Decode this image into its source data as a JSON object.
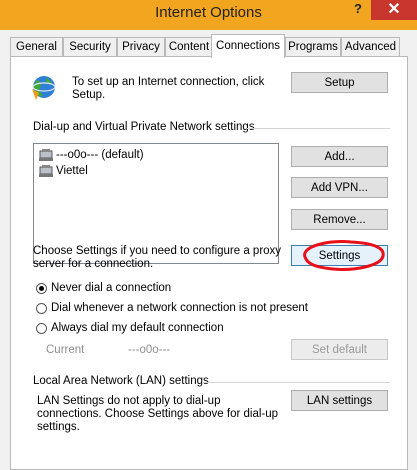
{
  "window": {
    "title": "Internet Options",
    "help_label": "?",
    "close_label": "✕",
    "titlebar_color": "#f2a51f",
    "close_color": "#c7352c"
  },
  "tabs": [
    {
      "label": "General"
    },
    {
      "label": "Security"
    },
    {
      "label": "Privacy"
    },
    {
      "label": "Content"
    },
    {
      "label": "Connections",
      "active": true
    },
    {
      "label": "Programs"
    },
    {
      "label": "Advanced"
    }
  ],
  "setup": {
    "text": "To set up an Internet connection, click Setup.",
    "button": "Setup"
  },
  "dialup": {
    "group_label": "Dial-up and Virtual Private Network settings",
    "connections": [
      {
        "name": "---o0o--- (default)"
      },
      {
        "name": "Viettel"
      }
    ],
    "add_button": "Add...",
    "add_vpn_button": "Add VPN...",
    "remove_button": "Remove...",
    "proxy_text": "Choose Settings if you need to configure a proxy server for a connection.",
    "settings_button": "Settings",
    "radios": [
      {
        "label": "Never dial a connection",
        "checked": true
      },
      {
        "label": "Dial whenever a network connection is not present",
        "checked": false
      },
      {
        "label": "Always dial my default connection",
        "checked": false
      }
    ],
    "current_label": "Current",
    "current_value": "---o0o---",
    "set_default_button": "Set default"
  },
  "lan": {
    "group_label": "Local Area Network (LAN) settings",
    "text": "LAN Settings do not apply to dial-up connections. Choose Settings above for dial-up settings.",
    "button": "LAN settings"
  },
  "annotation_color": "#e8101a"
}
